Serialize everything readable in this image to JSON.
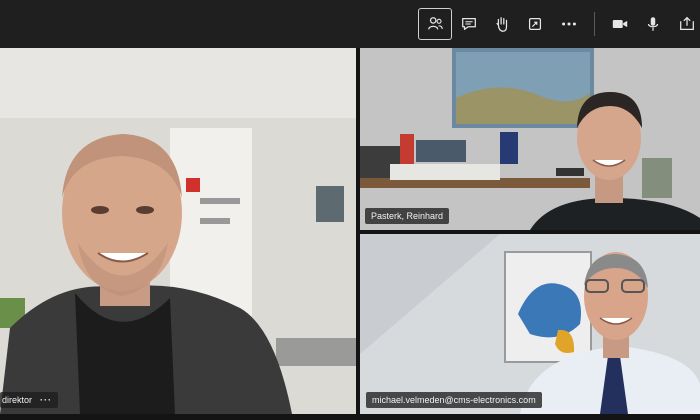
{
  "toolbar": {
    "buttons": [
      {
        "icon": "participants-icon",
        "active": true
      },
      {
        "icon": "chat-icon",
        "active": false
      },
      {
        "icon": "raise-hand-icon",
        "active": false
      },
      {
        "icon": "share-tray-icon",
        "active": false
      },
      {
        "icon": "more-options-icon",
        "active": false
      },
      {
        "icon": "camera-icon",
        "active": false
      },
      {
        "icon": "microphone-icon",
        "active": false
      },
      {
        "icon": "share-screen-icon",
        "active": false
      }
    ]
  },
  "participants": {
    "main": {
      "name": "direktor",
      "more": "···"
    },
    "top_right": {
      "name": "Pasterk, Reinhard"
    },
    "bottom_right": {
      "name": "michael.velmeden@cms-electronics.com"
    }
  },
  "colors": {
    "toolbar_bg": "#1f1f1f",
    "icon": "#e6e6e6",
    "tag_bg": "#1e1e1e"
  }
}
